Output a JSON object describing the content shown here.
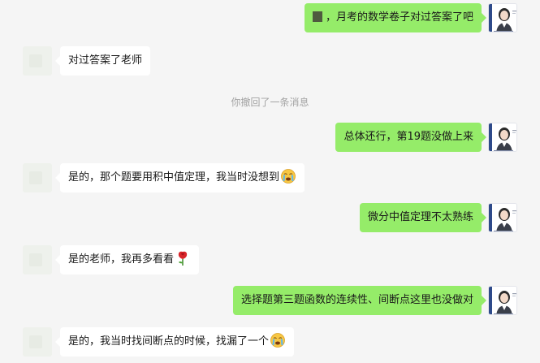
{
  "messages": [
    {
      "side": "right",
      "text": "，月考的数学卷子对过答案了吧",
      "redacted_prefix": true
    },
    {
      "side": "left",
      "text": "对过答案了老师"
    },
    {
      "side": "system",
      "text": "你撤回了一条消息"
    },
    {
      "side": "right",
      "text": "总体还行，第19题没做上来"
    },
    {
      "side": "left",
      "text": "是的，那个题要用积中值定理，我当时没想到",
      "emoji": "crying-face"
    },
    {
      "side": "right",
      "text": "微分中值定理不太熟练"
    },
    {
      "side": "left",
      "text": "是的老师，我再多看看",
      "emoji": "rose"
    },
    {
      "side": "right",
      "text": "选择题第三题函数的连续性、间断点这里也没做对"
    },
    {
      "side": "left",
      "text": "是的，我当时找间断点的时候，找漏了一个",
      "emoji": "crying-face"
    }
  ],
  "colors": {
    "background": "#f5f5f5",
    "my_bubble": "#95ec69",
    "their_bubble": "#ffffff",
    "system_text": "#a3a3a3"
  }
}
